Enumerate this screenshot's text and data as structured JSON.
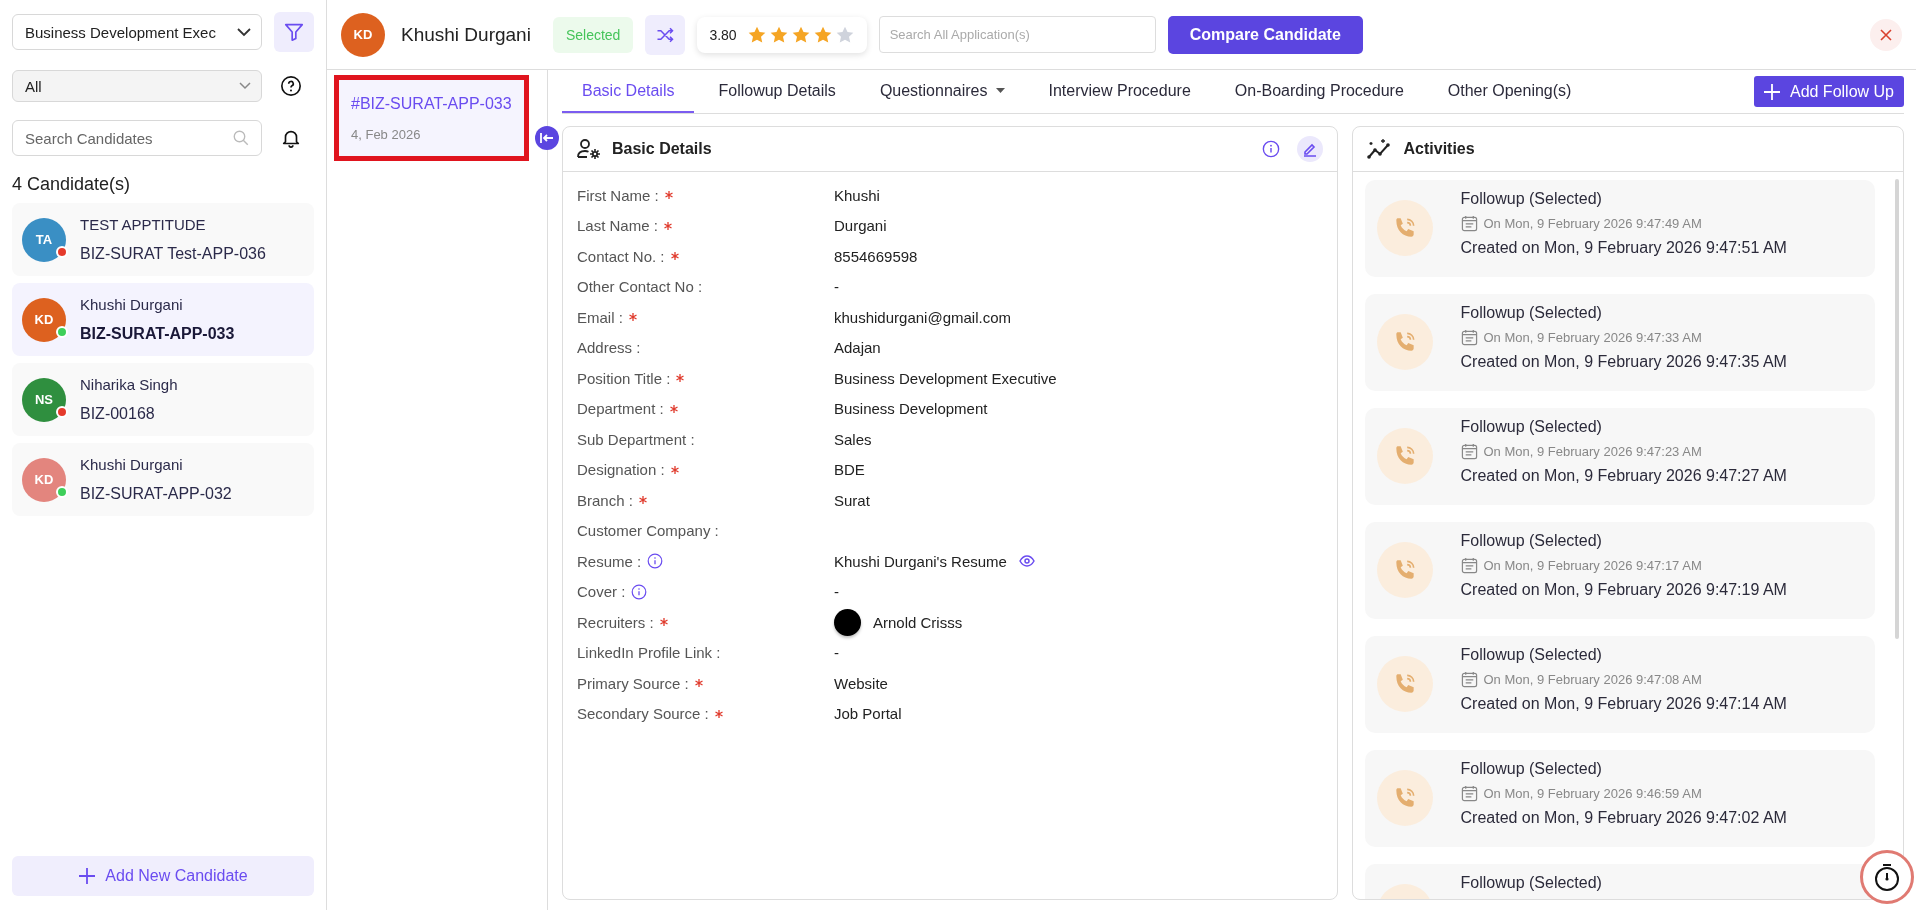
{
  "sidebar": {
    "position_select": {
      "value": "Business Development Exec"
    },
    "status_select": {
      "value": "All"
    },
    "search": {
      "placeholder": "Search Candidates"
    },
    "count_label": "4 Candidate(s)",
    "candidates": [
      {
        "avatar": {
          "initials": "TA",
          "color": "#3a8fc4"
        },
        "name": "TEST APPTITUDE",
        "code": "BIZ-SURAT Test-APP-036",
        "color": "#e53b2c",
        "selected": false
      },
      {
        "avatar": {
          "initials": "KD",
          "color": "#dd611f"
        },
        "name": "Khushi Durgani",
        "code": "BIZ-SURAT-APP-033",
        "color": "#3ecf5a",
        "selected": true
      },
      {
        "avatar": {
          "initials": "NS",
          "color": "#2f8f3f"
        },
        "name": "Niharika Singh",
        "code": "BIZ-00168",
        "color": "#e53b2c",
        "selected": false
      },
      {
        "avatar": {
          "initials": "KD",
          "color": "#e3857e"
        },
        "name": "Khushi Durgani",
        "code": "BIZ-SURAT-APP-032",
        "color": "#3ecf5a",
        "selected": false
      }
    ],
    "add_button": "Add New Candidate"
  },
  "applications": [
    {
      "code": "#BIZ-SURAT-APP-033",
      "date": "4, Feb 2026",
      "selected": true
    }
  ],
  "header": {
    "initials": "KD",
    "name": "Khushi Durgani",
    "status": "Selected",
    "rating": "3.80",
    "stars": 4,
    "search": {
      "placeholder": "Search All Application(s)"
    },
    "compare_button": "Compare Candidate"
  },
  "tabs": [
    {
      "label": "Basic Details",
      "selected": true,
      "dropdown": false
    },
    {
      "label": "Followup Details",
      "selected": false,
      "dropdown": false
    },
    {
      "label": "Questionnaires",
      "selected": false,
      "dropdown": true
    },
    {
      "label": "Interview Procedure",
      "selected": false,
      "dropdown": false
    },
    {
      "label": "On-Boarding Procedure",
      "selected": false,
      "dropdown": false
    },
    {
      "label": "Other Opening(s)",
      "selected": false,
      "dropdown": false
    }
  ],
  "add_follow_up": "Add Follow Up",
  "basic_details": {
    "title": "Basic Details",
    "fields": [
      {
        "label": "First Name :",
        "required": true,
        "info": false,
        "kind": "text",
        "value": "Khushi"
      },
      {
        "label": "Last Name :",
        "required": true,
        "info": false,
        "kind": "text",
        "value": "Durgani"
      },
      {
        "label": "Contact No. :",
        "required": true,
        "info": false,
        "kind": "text",
        "value": "8554669598"
      },
      {
        "label": "Other Contact No :",
        "required": false,
        "info": false,
        "kind": "text",
        "value": "-"
      },
      {
        "label": "Email :",
        "required": true,
        "info": false,
        "kind": "text",
        "value": "khushidurgani@gmail.com"
      },
      {
        "label": "Address :",
        "required": false,
        "info": false,
        "kind": "text",
        "value": "Adajan"
      },
      {
        "label": "Position Title :",
        "required": true,
        "info": false,
        "kind": "text",
        "value": "Business Development Executive"
      },
      {
        "label": "Department :",
        "required": true,
        "info": false,
        "kind": "text",
        "value": "Business Development"
      },
      {
        "label": "Sub Department :",
        "required": false,
        "info": false,
        "kind": "text",
        "value": "Sales"
      },
      {
        "label": "Designation :",
        "required": true,
        "info": false,
        "kind": "text",
        "value": "BDE"
      },
      {
        "label": "Branch :",
        "required": true,
        "info": false,
        "kind": "text",
        "value": "Surat"
      },
      {
        "label": "Customer Company :",
        "required": false,
        "info": false,
        "kind": "text"
      },
      {
        "label": "Resume :",
        "required": false,
        "info": true,
        "kind": "document",
        "value": "Khushi Durgani's Resume"
      },
      {
        "label": "Cover :",
        "required": false,
        "info": true,
        "kind": "text",
        "value": "-"
      },
      {
        "label": "Recruiters :",
        "required": true,
        "info": false,
        "kind": "person",
        "value": "Arnold Crisss"
      },
      {
        "label": "LinkedIn Profile Link :",
        "required": false,
        "info": false,
        "kind": "text",
        "value": "-"
      },
      {
        "label": "Primary Source :",
        "required": true,
        "info": false,
        "kind": "text",
        "value": "Website"
      },
      {
        "label": "Secondary Source :",
        "required": true,
        "info": false,
        "kind": "text",
        "value": "Job Portal"
      }
    ]
  },
  "activities": {
    "title": "Activities",
    "items": [
      {
        "title": "Followup (Selected)",
        "on": "On Mon, 9 February 2026 9:47:49 AM",
        "created": "Created on Mon, 9 February 2026 9:47:51 AM"
      },
      {
        "title": "Followup (Selected)",
        "on": "On Mon, 9 February 2026 9:47:33 AM",
        "created": "Created on Mon, 9 February 2026 9:47:35 AM"
      },
      {
        "title": "Followup (Selected)",
        "on": "On Mon, 9 February 2026 9:47:23 AM",
        "created": "Created on Mon, 9 February 2026 9:47:27 AM"
      },
      {
        "title": "Followup (Selected)",
        "on": "On Mon, 9 February 2026 9:47:17 AM",
        "created": "Created on Mon, 9 February 2026 9:47:19 AM"
      },
      {
        "title": "Followup (Selected)",
        "on": "On Mon, 9 February 2026 9:47:08 AM",
        "created": "Created on Mon, 9 February 2026 9:47:14 AM"
      },
      {
        "title": "Followup (Selected)",
        "on": "On Mon, 9 February 2026 9:46:59 AM",
        "created": "Created on Mon, 9 February 2026 9:47:02 AM"
      },
      {
        "title": "Followup (Selected)"
      }
    ]
  }
}
